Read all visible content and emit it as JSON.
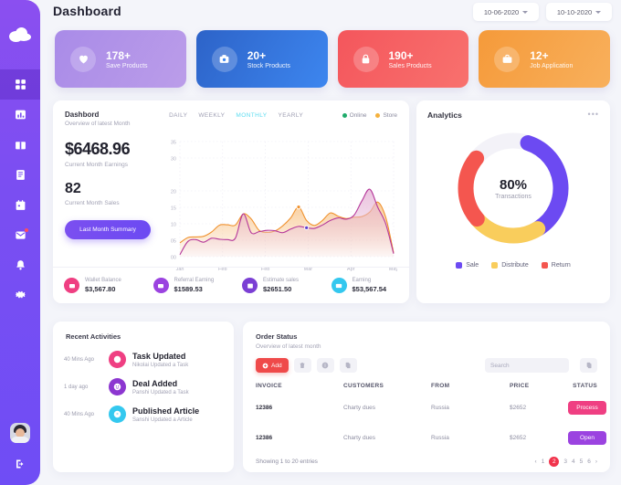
{
  "header": {
    "title": "Dashboard",
    "date_from": "10-06-2020",
    "date_to": "10-10-2020"
  },
  "sidebar": {
    "logo": "cloud-logo",
    "items": [
      {
        "icon": "grid-icon",
        "name": "dashboard",
        "active": true
      },
      {
        "icon": "bar-chart-icon",
        "name": "analytics",
        "active": false
      },
      {
        "icon": "gift-icon",
        "name": "gifts",
        "active": false
      },
      {
        "icon": "document-icon",
        "name": "documents",
        "active": false
      },
      {
        "icon": "calendar-icon",
        "name": "calendar",
        "active": false
      },
      {
        "icon": "mail-icon",
        "name": "messages",
        "active": false,
        "badge": true
      },
      {
        "icon": "bell-icon",
        "name": "notifications",
        "active": false
      },
      {
        "icon": "gear-icon",
        "name": "settings",
        "active": false
      }
    ],
    "avatar": "user-avatar",
    "logout": "logout-icon"
  },
  "kpis": [
    {
      "value": "178+",
      "label": "Save Products",
      "icon": "heart-icon",
      "c1": "#a98be8",
      "c2": "#bb9de9"
    },
    {
      "value": "20+",
      "label": "Stock Products",
      "icon": "camera-icon",
      "c1": "#2d63c8",
      "c2": "#3d86ef"
    },
    {
      "value": "190+",
      "label": "Sales Products",
      "icon": "lock-icon",
      "c1": "#f4565c",
      "c2": "#f8716e"
    },
    {
      "value": "12+",
      "label": "Job Application",
      "icon": "briefcase-icon",
      "c1": "#f59a3a",
      "c2": "#f8b05c"
    }
  ],
  "earnings": {
    "title": "Dashbord",
    "subtitle": "Overview of latest Month",
    "money": "$6468.96",
    "money_label": "Current Month Earnings",
    "count": "82",
    "count_label": "Current Month Sales",
    "button": "Last Month Summary",
    "tabs": [
      {
        "label": "DAILY",
        "active": false
      },
      {
        "label": "WEEKLY",
        "active": false
      },
      {
        "label": "MONTHLY",
        "active": true
      },
      {
        "label": "YEARLY",
        "active": false
      }
    ],
    "legend": [
      {
        "label": "Online",
        "color": "#1fab6b"
      },
      {
        "label": "Store",
        "color": "#f5b13d"
      }
    ]
  },
  "chart_data": {
    "type": "area",
    "title": "Dashbord - Overview of latest Month",
    "xlabel": "",
    "ylabel": "",
    "ylim": [
      0,
      35
    ],
    "yticks": [
      "00",
      "05",
      "10",
      "15",
      "20",
      "30",
      "35"
    ],
    "ytick_values": [
      0,
      5,
      10,
      15,
      20,
      30,
      35
    ],
    "xticks": [
      "Jan",
      "Feb",
      "Feb",
      "Mar",
      "Apr",
      "May"
    ],
    "grid": true,
    "legend_position": "top-right",
    "series": [
      {
        "name": "Store",
        "color": "#f0922f",
        "fill": "#f8c489",
        "values": [
          4.2,
          5.8,
          6.0,
          6.2,
          7.5,
          9.6,
          9.7,
          9.6,
          13.0,
          11.5,
          8.0,
          7.4,
          7.8,
          9.4,
          11.8,
          15.1,
          11.0,
          9.5,
          11.0,
          13.3,
          12.3,
          11.6,
          12.0,
          12.2,
          13.6,
          16.6,
          12.0,
          1.2
        ],
        "marker": {
          "x_index": 15,
          "value": 15.1
        }
      },
      {
        "name": "Online",
        "color": "#b5379a",
        "fill": "#e7b8d8",
        "values": [
          0.6,
          4.6,
          5.2,
          4.4,
          5.6,
          5.3,
          5.2,
          5.6,
          13.0,
          7.3,
          7.6,
          8.0,
          7.9,
          7.3,
          8.4,
          9.2,
          8.8,
          8.6,
          9.6,
          11.0,
          11.8,
          11.4,
          12.6,
          17.0,
          20.5,
          15.0,
          10.0,
          0.9
        ],
        "marker": {
          "x_index": 16,
          "value": 8.8
        }
      }
    ]
  },
  "mini_stats": [
    {
      "label": "Wallet Balance",
      "value": "$3,567.80",
      "icon": "wallet-icon",
      "color": "#ef3f82"
    },
    {
      "label": "Referral Earning",
      "value": "$1589.53",
      "icon": "wallet-icon",
      "color": "#9b43e0"
    },
    {
      "label": "Estimate sales",
      "value": "$2651.50",
      "icon": "calendar-icon",
      "color": "#7b3fd4"
    },
    {
      "label": "Earning",
      "value": "$53,567.54",
      "icon": "card-icon",
      "color": "#34c8ef"
    }
  ],
  "analytics": {
    "title": "Analytics",
    "menu_icon": "more-dots-icon",
    "chart_data": {
      "type": "pie",
      "title": "Analytics",
      "center_value": "80%",
      "center_label": "Transactions",
      "categories": [
        "Sale",
        "Distribute",
        "Return"
      ],
      "values": [
        36,
        22,
        22
      ],
      "gap": 20,
      "colors": [
        "#6c4af2",
        "#f9cd5c",
        "#f4564f"
      ],
      "legend_position": "bottom"
    },
    "legend": [
      {
        "label": "Sale",
        "color": "#6c4af2"
      },
      {
        "label": "Distribute",
        "color": "#f9cd5c"
      },
      {
        "label": "Return",
        "color": "#f4564f"
      }
    ]
  },
  "activities": {
    "title": "Recent Activities",
    "items": [
      {
        "time": "40 Mins Ago",
        "heading": "Task Updated",
        "sub": "Nikolai Updated a Task",
        "icon": "check-circle-icon",
        "color": "#ef3f82"
      },
      {
        "time": "1 day ago",
        "heading": "Deal Added",
        "sub": "Panshi Updated a Task",
        "icon": "smile-icon",
        "color": "#8c36d0"
      },
      {
        "time": "40 Mins Ago",
        "heading": "Published Article",
        "sub": "Sanshi Updated a Article",
        "icon": "article-icon",
        "color": "#34c8ef"
      }
    ]
  },
  "order_status": {
    "title": "Order Status",
    "subtitle": "Overview of latest month",
    "add_label": "Add",
    "tools": [
      {
        "icon": "trash-icon",
        "name": "delete-button"
      },
      {
        "icon": "info-icon",
        "name": "info-button"
      },
      {
        "icon": "copy-icon",
        "name": "copy-button"
      }
    ],
    "search_placeholder": "Search",
    "export_icon": "export-icon",
    "columns": [
      "INVOICE",
      "CUSTOMERS",
      "FROM",
      "PRICE",
      "STATUS"
    ],
    "rows": [
      {
        "invoice": "12386",
        "customer": "Charty dues",
        "from": "Russia",
        "price": "$2652",
        "status": "Process",
        "status_class": "process"
      },
      {
        "invoice": "12386",
        "customer": "Charty dues",
        "from": "Russia",
        "price": "$2652",
        "status": "Open",
        "status_class": "open"
      }
    ],
    "showing": "Showing 1 to 20 entries",
    "pager": {
      "prev": "‹",
      "next": "›",
      "pages": [
        "1",
        "2",
        "3",
        "4",
        "5",
        "6"
      ],
      "active": "2"
    }
  }
}
